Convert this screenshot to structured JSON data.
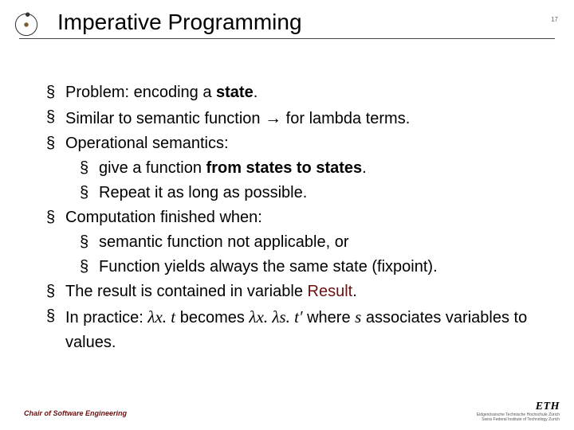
{
  "header": {
    "title": "Imperative Programming",
    "page_number": "17"
  },
  "bullets": {
    "b1a": "Problem: encoding a ",
    "b1b": "state",
    "b1c": ".",
    "b2a": "Similar to semantic function ",
    "b2arrow": "→",
    "b2b": " for lambda terms.",
    "b3": "Operational semantics:",
    "b3_1a": "give a function ",
    "b3_1b": "from states to states",
    "b3_1c": ".",
    "b3_2": "Repeat it as long as possible.",
    "b4": "Computation finished when:",
    "b4_1": "semantic function not applicable, or",
    "b4_2": "Function yields always the same state (fixpoint).",
    "b5a": "The result is contained in variable ",
    "b5b": "Result",
    "b5c": ".",
    "b6a": "In practice: ",
    "b6m1": "λx. t",
    "b6b": " becomes ",
    "b6m2": "λx. λs. t′",
    "b6c": " where ",
    "b6m3": "s",
    "b6d": " associates variables to values."
  },
  "footer": {
    "chair": "Chair of Software Engineering",
    "eth": "ETH",
    "eth_sub1": "Eidgenössische Technische Hochschule Zürich",
    "eth_sub2": "Swiss Federal Institute of Technology Zurich"
  }
}
